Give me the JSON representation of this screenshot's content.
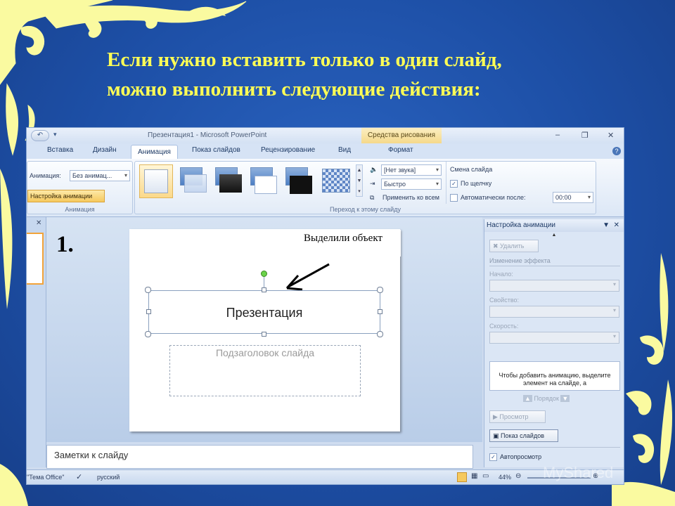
{
  "heading": {
    "line1": "Если нужно вставить только в один слайд,",
    "line2": "можно  выполнить следующие действия:"
  },
  "colors": {
    "slide_background": "#1f4e9e",
    "ornament": "#fafaa0",
    "heading_text": "#ffff55"
  },
  "app": {
    "window_title": "Презентация1 - Microsoft PowerPoint",
    "contextual_group": "Средства рисования",
    "tabs": [
      "Вставка",
      "Дизайн",
      "Анимация",
      "Показ слайдов",
      "Рецензирование",
      "Вид",
      "Формат"
    ],
    "active_tab": "Анимация",
    "ribbon": {
      "animation_group": {
        "animation_label": "Анимация:",
        "animation_value": "Без анимац...",
        "custom_animation_button": "Настройка анимации",
        "group_label": "Анимация"
      },
      "transition_group": {
        "sound_value": "[Нет звука]",
        "speed_value": "Быстро",
        "apply_all_button": "Применить ко всем",
        "advance_title": "Смена слайда",
        "on_click_label": "По щелчку",
        "on_click_checked": true,
        "auto_after_label": "Автоматически после:",
        "auto_after_checked": false,
        "auto_after_value": "00:00",
        "group_label": "Переход к этому слайду"
      }
    },
    "slide": {
      "number_label": "1.",
      "callout": "Выделили объект",
      "title_placeholder": "Презентация",
      "subtitle_placeholder": "Подзаголовок слайда"
    },
    "notes_placeholder": "Заметки к слайду",
    "status": {
      "theme": "\"Тема Office\"",
      "language": "русский",
      "zoom": "44%"
    },
    "custom_animation_pane": {
      "title": "Настройка анимации",
      "remove_button": "Удалить",
      "change_effect": "Изменение эффекта",
      "start_label": "Начало:",
      "property_label": "Свойство:",
      "speed_label": "Скорость:",
      "info_text": "Чтобы добавить анимацию, выделите элемент на слайде, а",
      "order_label": "Порядок",
      "preview_button": "Просмотр",
      "slideshow_button": "Показ слайдов",
      "autopreview_label": "Автопросмотр",
      "autopreview_checked": true
    }
  },
  "watermark": "MyShared"
}
